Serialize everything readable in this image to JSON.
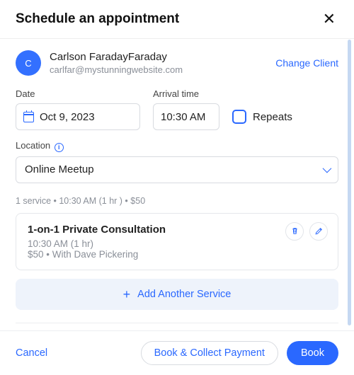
{
  "header": {
    "title": "Schedule an appointment"
  },
  "client": {
    "initial": "C",
    "name": "Carlson FaradayFaraday",
    "email": "carlfar@mystunningwebsite.com",
    "change_label": "Change Client"
  },
  "labels": {
    "date": "Date",
    "arrival_time": "Arrival time",
    "repeats": "Repeats",
    "location": "Location"
  },
  "form": {
    "date_value": "Oct 9, 2023",
    "time_value": "10:30 AM",
    "location_value": "Online Meetup"
  },
  "summary": "1 service • 10:30 AM (1 hr ) • $50",
  "service": {
    "title": "1-on-1 Private Consultation",
    "line1": "10:30 AM  (1 hr)",
    "line2": "$50 • With Dave Pickering"
  },
  "add_service": "Add Another Service",
  "footer": {
    "cancel": "Cancel",
    "book_collect": "Book & Collect Payment",
    "book": "Book"
  }
}
